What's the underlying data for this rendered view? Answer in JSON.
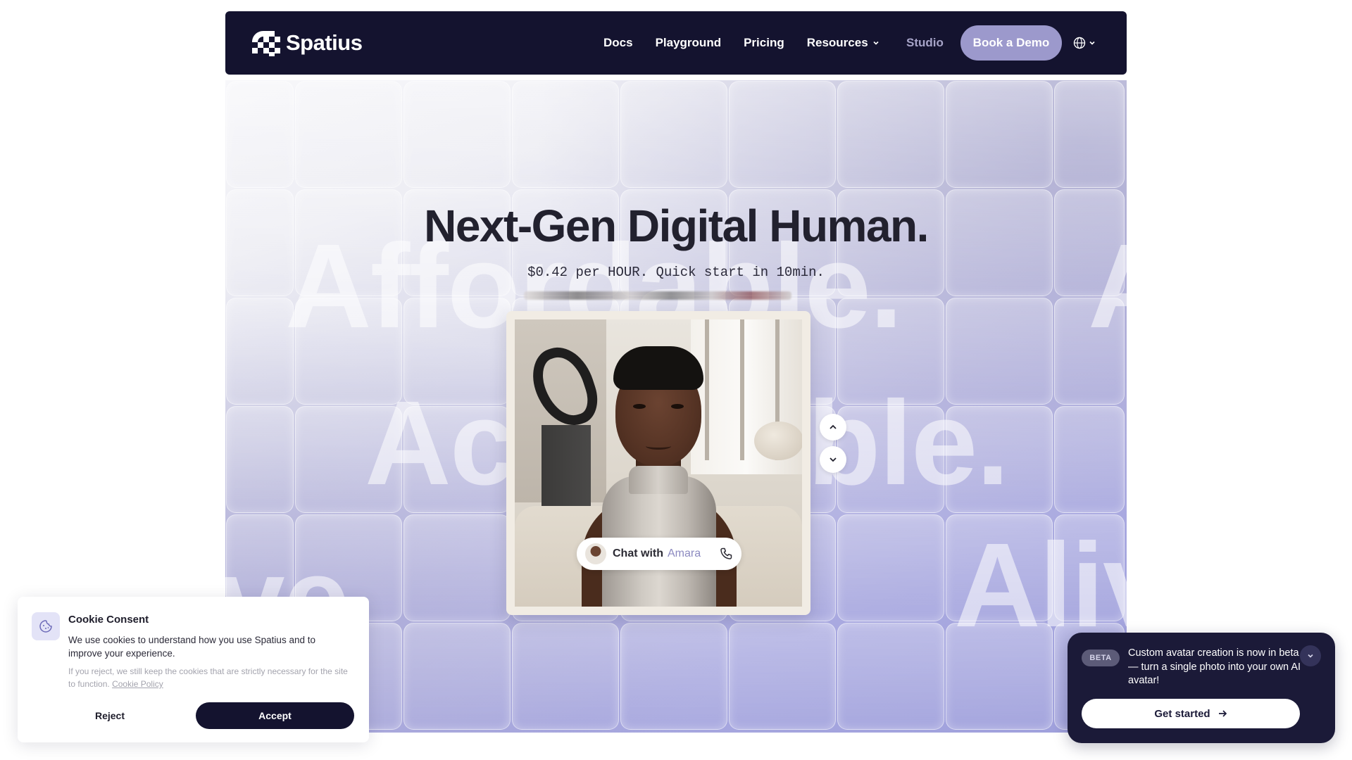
{
  "nav": {
    "brand": "Spatius",
    "links": [
      {
        "label": "Docs"
      },
      {
        "label": "Playground"
      },
      {
        "label": "Pricing"
      },
      {
        "label": "Resources"
      }
    ],
    "studio_label": "Studio",
    "demo_label": "Book a Demo",
    "language_icon": "globe-icon"
  },
  "hero": {
    "headline": "Next-Gen Digital Human.",
    "subheadline": "$0.42 per HOUR. Quick start in 10min.",
    "background_words": [
      "Affordable.",
      "Accessible.",
      "Alive.",
      "A",
      "ve",
      "Aliv"
    ],
    "chat": {
      "prefix": "Chat with",
      "name": "Amara"
    }
  },
  "cookie": {
    "title": "Cookie Consent",
    "body": "We use cookies to understand how you use Spatius and to improve your experience.",
    "fine_print": "If you reject, we still keep the cookies that are strictly necessary for the site to function.",
    "policy_link": "Cookie Policy",
    "reject_label": "Reject",
    "accept_label": "Accept"
  },
  "beta_toast": {
    "tag": "BETA",
    "message": "Custom avatar creation is now in beta — turn a single photo into your own AI avatar!",
    "cta_label": "Get started"
  },
  "colors": {
    "nav_bg": "#14132f",
    "accent": "#9c99cc",
    "toast_bg": "#1b1a38"
  }
}
